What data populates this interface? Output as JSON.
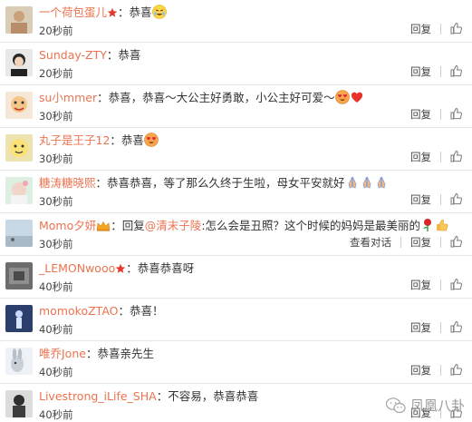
{
  "comments": [
    {
      "user": "一个荷包蛋儿",
      "text": "恭喜",
      "time": "20秒前",
      "badge": "red-star",
      "emojis": [
        "tearful-laugh-emoji"
      ]
    },
    {
      "user": "Sunday-ZTY",
      "text": "恭喜",
      "time": "20秒前"
    },
    {
      "user": "su小mmer",
      "text": "恭喜，恭喜～大公主好勇敢，小公主好可爱～",
      "time": "30秒前",
      "emojis": [
        "heart-eyes-emoji",
        "red-heart-emoji"
      ]
    },
    {
      "user": "丸子是王子12",
      "text": "恭喜",
      "time": "30秒前",
      "emojis": [
        "heart-eyes-emoji"
      ]
    },
    {
      "user": "糖涛糖晓熙",
      "text": "恭喜恭喜，等了那么久终于生啦，母女平安就好",
      "time": "30秒前",
      "emojis": [
        "pray-emoji",
        "pray-emoji",
        "pray-emoji"
      ]
    },
    {
      "user": "Momo夕妍",
      "reply_prefix": "回复",
      "mention": "@清末子陵",
      "text": ":怎么会是丑照？这个时候的妈妈是最美丽的",
      "time": "30秒前",
      "badge": "vip-crown",
      "emojis": [
        "rose-emoji",
        "thumbs-up-emoji"
      ],
      "show_conversation": true,
      "conversation_label": "查看对话"
    },
    {
      "user": "_LEMONwooo",
      "text": "恭喜恭喜呀",
      "time": "40秒前",
      "badge": "red-star"
    },
    {
      "user": "momokoZTAO",
      "text": "恭喜！",
      "time": "40秒前"
    },
    {
      "user": "唯乔Jone",
      "text": "恭喜亲先生",
      "time": "40秒前"
    },
    {
      "user": "Livestrong_iLife_SHA",
      "text": "不容易，恭喜恭喜",
      "time": "40秒前"
    }
  ],
  "labels": {
    "reply": "回复",
    "colon": "："
  },
  "watermark": {
    "text": "凤凰八卦",
    "icon": "wechat-icon"
  },
  "colors": {
    "username": "#eb7350",
    "text": "#333333",
    "divider": "#e6e6e6",
    "watermark": "#9a9a9a"
  }
}
